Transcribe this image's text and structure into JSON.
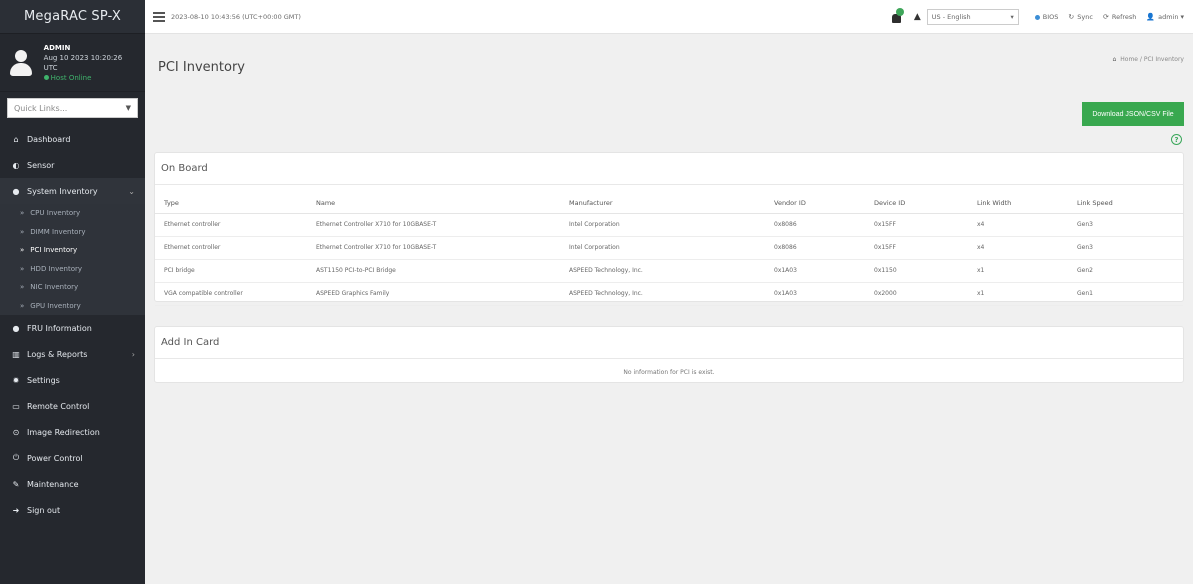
{
  "sidebar": {
    "brand": "MegaRAC SP-X",
    "user": {
      "name": "ADMIN",
      "login_time": "Aug 10 2023 10:20:26 UTC",
      "status": "Host Online"
    },
    "quick_links_placeholder": "Quick Links...",
    "items": [
      {
        "label": "Dashboard",
        "icon": "home-icon"
      },
      {
        "label": "Sensor",
        "icon": "gauge-icon"
      },
      {
        "label": "System Inventory",
        "icon": "inventory-icon"
      },
      {
        "label": "FRU Information",
        "icon": "info-icon"
      },
      {
        "label": "Logs & Reports",
        "icon": "chart-icon"
      },
      {
        "label": "Settings",
        "icon": "gear-icon"
      },
      {
        "label": "Remote Control",
        "icon": "monitor-icon"
      },
      {
        "label": "Image Redirection",
        "icon": "disc-icon"
      },
      {
        "label": "Power Control",
        "icon": "power-icon"
      },
      {
        "label": "Maintenance",
        "icon": "wrench-icon"
      },
      {
        "label": "Sign out",
        "icon": "signout-icon"
      }
    ],
    "sub_items": [
      {
        "label": "CPU Inventory"
      },
      {
        "label": "DIMM Inventory"
      },
      {
        "label": "PCI Inventory"
      },
      {
        "label": "HDD Inventory"
      },
      {
        "label": "NIC Inventory"
      },
      {
        "label": "GPU Inventory"
      }
    ]
  },
  "header": {
    "clock": "2023-08-10 10:43:56 (UTC+00:00 GMT)",
    "language": "US - English",
    "bios": "BIOS",
    "sync": "Sync",
    "refresh": "Refresh",
    "user": "admin"
  },
  "main": {
    "title": "PCI Inventory",
    "breadcrumb_home": "Home",
    "breadcrumb_current": "PCI Inventory",
    "download_label": "Download JSON/CSV File",
    "onboard": {
      "title": "On Board",
      "columns": [
        "Type",
        "Name",
        "Manufacturer",
        "Vendor ID",
        "Device ID",
        "Link Width",
        "Link Speed"
      ],
      "rows": [
        [
          "Ethernet controller",
          "Ethernet Controller X710 for 10GBASE-T",
          "Intel Corporation",
          "0x8086",
          "0x15FF",
          "x4",
          "Gen3"
        ],
        [
          "Ethernet controller",
          "Ethernet Controller X710 for 10GBASE-T",
          "Intel Corporation",
          "0x8086",
          "0x15FF",
          "x4",
          "Gen3"
        ],
        [
          "PCI bridge",
          "AST1150 PCI-to-PCI Bridge",
          "ASPEED Technology, Inc.",
          "0x1A03",
          "0x1150",
          "x1",
          "Gen2"
        ],
        [
          "VGA compatible controller",
          "ASPEED Graphics Family",
          "ASPEED Technology, Inc.",
          "0x1A03",
          "0x2000",
          "x1",
          "Gen1"
        ]
      ]
    },
    "addin": {
      "title": "Add In Card",
      "empty_text": "No information for PCI is exist."
    }
  }
}
